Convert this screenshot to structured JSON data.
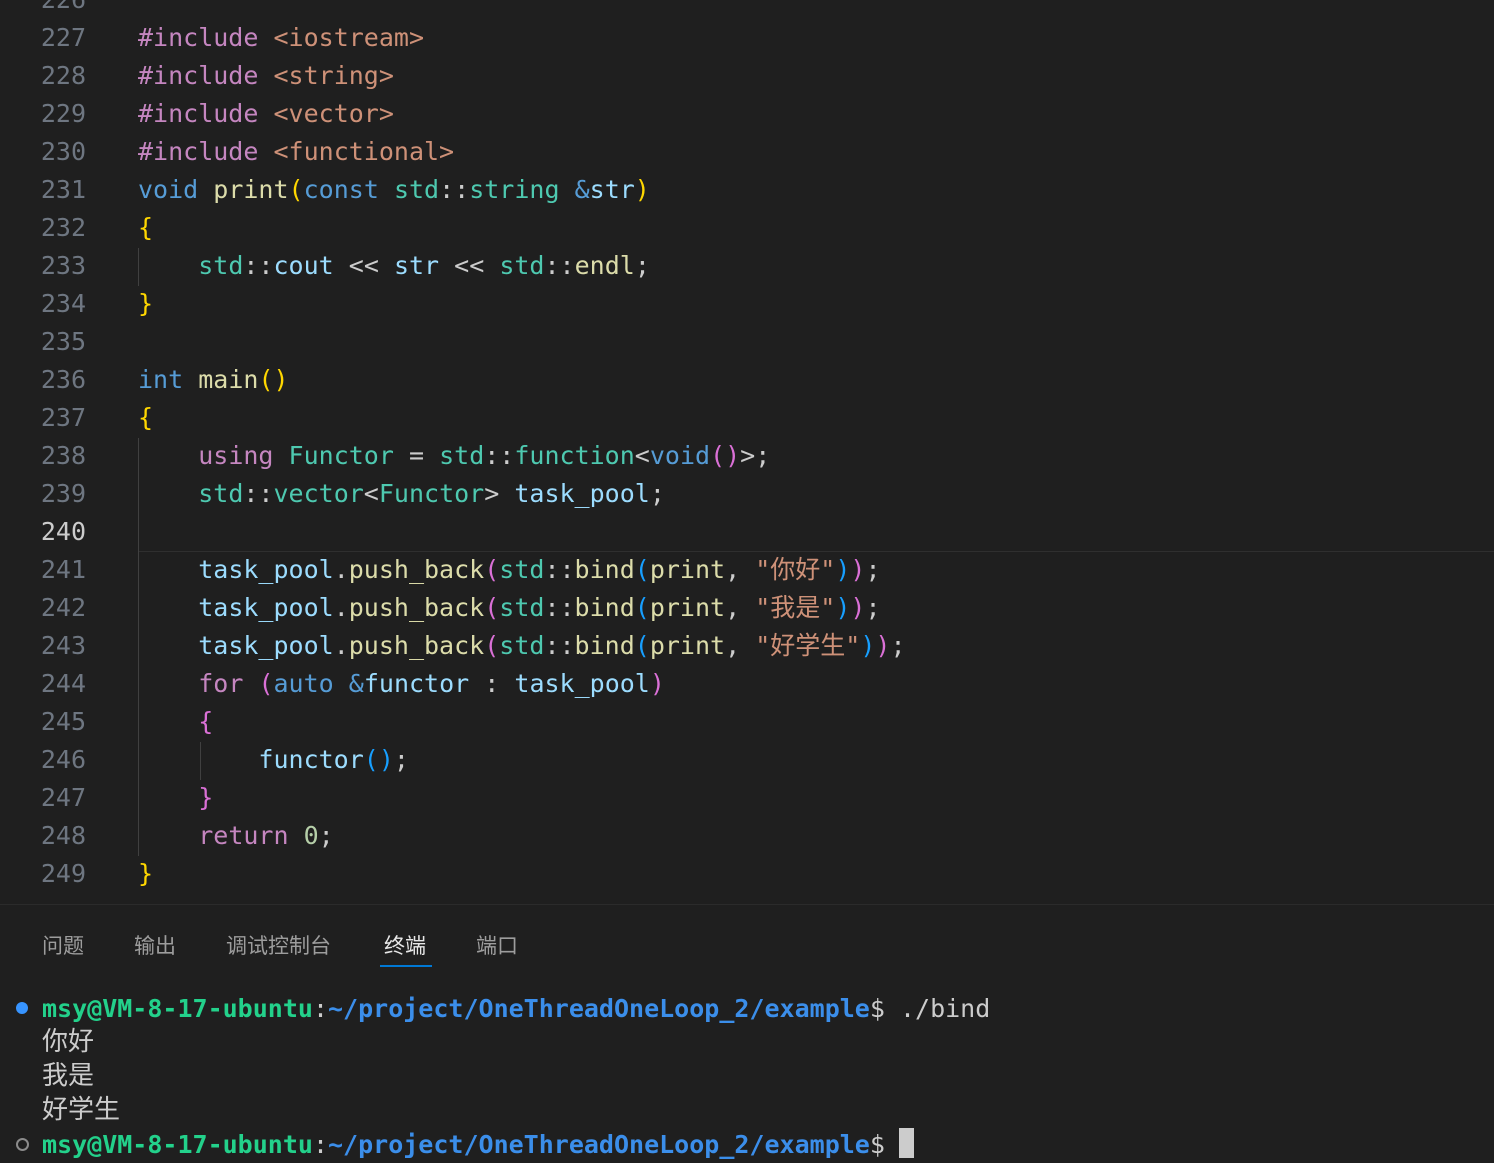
{
  "editor": {
    "lines": [
      {
        "n": "226",
        "html": ""
      },
      {
        "n": "227",
        "html": "<span class=\"ctl\">#include</span> <span class=\"str\">&lt;iostream&gt;</span>"
      },
      {
        "n": "228",
        "html": "<span class=\"ctl\">#include</span> <span class=\"str\">&lt;string&gt;</span>"
      },
      {
        "n": "229",
        "html": "<span class=\"ctl\">#include</span> <span class=\"str\">&lt;vector&gt;</span>"
      },
      {
        "n": "230",
        "html": "<span class=\"ctl\">#include</span> <span class=\"str\">&lt;functional&gt;</span>"
      },
      {
        "n": "231",
        "html": "<span class=\"kw\">void</span> <span class=\"fn\">print</span><span class=\"b1\">(</span><span class=\"kw\">const</span> <span class=\"typ\">std</span><span class=\"pl\">::</span><span class=\"typ\">string</span> <span class=\"kw\">&amp;</span><span class=\"var\">str</span><span class=\"b1\">)</span>"
      },
      {
        "n": "232",
        "html": "<span class=\"b1\">{</span>"
      },
      {
        "n": "233",
        "html": "    <span class=\"typ\">std</span><span class=\"pl\">::</span><span class=\"var\">cout</span> <span class=\"pl\">&lt;&lt;</span> <span class=\"var\">str</span> <span class=\"pl\">&lt;&lt;</span> <span class=\"typ\">std</span><span class=\"pl\">::</span><span class=\"fn\">endl</span><span class=\"pl\">;</span>"
      },
      {
        "n": "234",
        "html": "<span class=\"b1\">}</span>"
      },
      {
        "n": "235",
        "html": ""
      },
      {
        "n": "236",
        "html": "<span class=\"kw\">int</span> <span class=\"fn\">main</span><span class=\"b1\">()</span>"
      },
      {
        "n": "237",
        "html": "<span class=\"b1\">{</span>"
      },
      {
        "n": "238",
        "html": "    <span class=\"ctl\">using</span> <span class=\"typ\">Functor</span> <span class=\"pl\">=</span> <span class=\"typ\">std</span><span class=\"pl\">::</span><span class=\"typ\">function</span><span class=\"pl\">&lt;</span><span class=\"kw\">void</span><span class=\"b2\">()</span><span class=\"pl\">&gt;;</span>"
      },
      {
        "n": "239",
        "html": "    <span class=\"typ\">std</span><span class=\"pl\">::</span><span class=\"typ\">vector</span><span class=\"pl\">&lt;</span><span class=\"typ\">Functor</span><span class=\"pl\">&gt;</span> <span class=\"var\">task_pool</span><span class=\"pl\">;</span>"
      },
      {
        "n": "240",
        "html": "",
        "current": true
      },
      {
        "n": "241",
        "html": "    <span class=\"var\">task_pool</span><span class=\"pl\">.</span><span class=\"fn\">push_back</span><span class=\"b2\">(</span><span class=\"typ\">std</span><span class=\"pl\">::</span><span class=\"fn\">bind</span><span class=\"b3\">(</span><span class=\"fn\">print</span><span class=\"pl\">, </span><span class=\"str\">\"你好\"</span><span class=\"b3\">)</span><span class=\"b2\">)</span><span class=\"pl\">;</span>"
      },
      {
        "n": "242",
        "html": "    <span class=\"var\">task_pool</span><span class=\"pl\">.</span><span class=\"fn\">push_back</span><span class=\"b2\">(</span><span class=\"typ\">std</span><span class=\"pl\">::</span><span class=\"fn\">bind</span><span class=\"b3\">(</span><span class=\"fn\">print</span><span class=\"pl\">, </span><span class=\"str\">\"我是\"</span><span class=\"b3\">)</span><span class=\"b2\">)</span><span class=\"pl\">;</span>"
      },
      {
        "n": "243",
        "html": "    <span class=\"var\">task_pool</span><span class=\"pl\">.</span><span class=\"fn\">push_back</span><span class=\"b2\">(</span><span class=\"typ\">std</span><span class=\"pl\">::</span><span class=\"fn\">bind</span><span class=\"b3\">(</span><span class=\"fn\">print</span><span class=\"pl\">, </span><span class=\"str\">\"好学生\"</span><span class=\"b3\">)</span><span class=\"b2\">)</span><span class=\"pl\">;</span>"
      },
      {
        "n": "244",
        "html": "    <span class=\"ctl\">for</span> <span class=\"b2\">(</span><span class=\"kw\">auto</span> <span class=\"kw\">&amp;</span><span class=\"var\">functor</span> <span class=\"pl\">:</span> <span class=\"var\">task_pool</span><span class=\"b2\">)</span>"
      },
      {
        "n": "245",
        "html": "    <span class=\"b2\">{</span>"
      },
      {
        "n": "246",
        "html": "        <span class=\"var\">functor</span><span class=\"b3\">()</span><span class=\"pl\">;</span>"
      },
      {
        "n": "247",
        "html": "    <span class=\"b2\">}</span>"
      },
      {
        "n": "248",
        "html": "    <span class=\"ctl\">return</span> <span class=\"num\">0</span><span class=\"pl\">;</span>"
      },
      {
        "n": "249",
        "html": "<span class=\"b1\">}</span>"
      }
    ]
  },
  "panel": {
    "tabs": [
      {
        "label": "问题",
        "name": "tab-problems"
      },
      {
        "label": "输出",
        "name": "tab-output"
      },
      {
        "label": "调试控制台",
        "name": "tab-debug-console"
      },
      {
        "label": "终端",
        "name": "tab-terminal",
        "active": true
      },
      {
        "label": "端口",
        "name": "tab-ports"
      }
    ]
  },
  "terminal": {
    "prompt1": {
      "user": "msy@VM-8-17-ubuntu",
      "sep": ":",
      "path": "~/project/OneThreadOneLoop_2/example",
      "dollar": "$",
      "command": " ./bind"
    },
    "output": [
      "你好",
      "我是",
      "好学生"
    ],
    "prompt2": {
      "user": "msy@VM-8-17-ubuntu",
      "sep": ":",
      "path": "~/project/OneThreadOneLoop_2/example",
      "dollar": "$"
    }
  },
  "colors": {
    "accent": "#0078d4",
    "terminal_user": "#23d18b",
    "terminal_path": "#3b8eea"
  }
}
